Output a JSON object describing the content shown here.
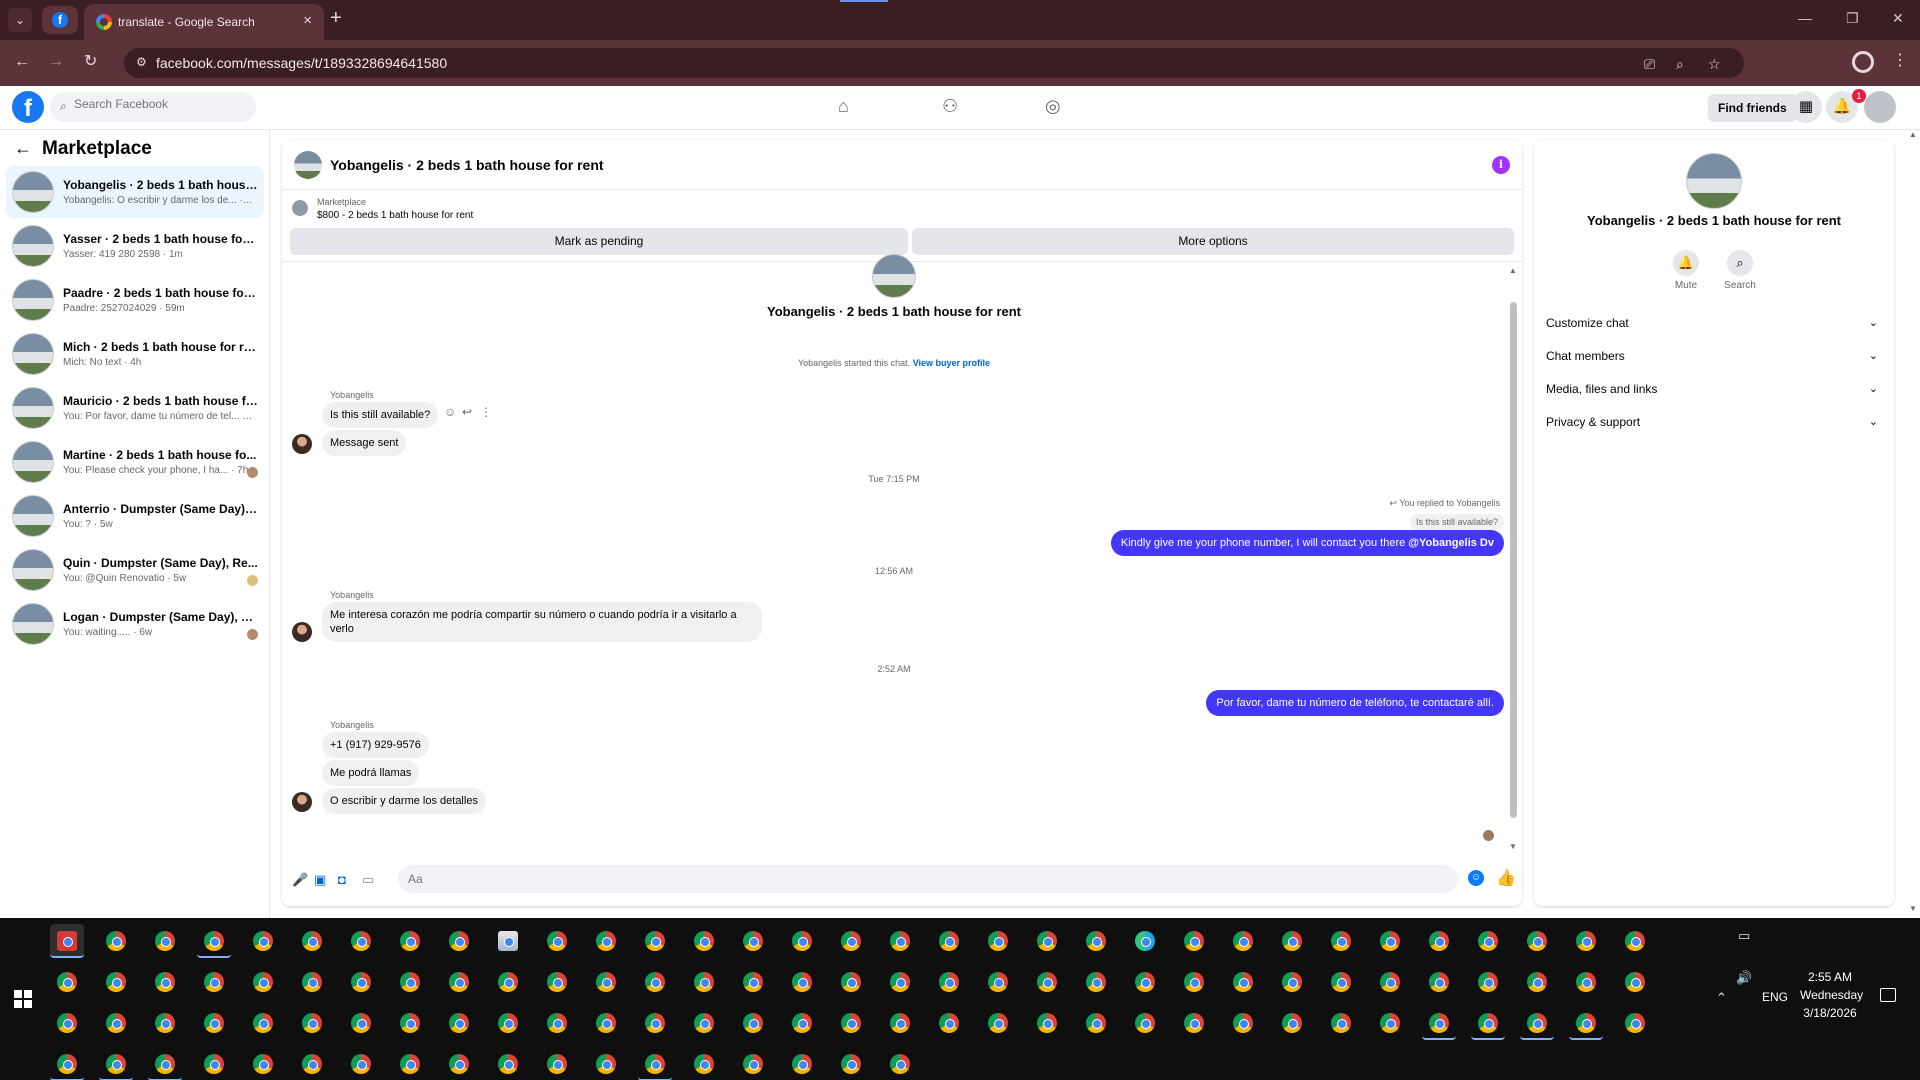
{
  "browser": {
    "tab_title": "translate - Google Search",
    "url": "facebook.com/messages/t/1893328694641580",
    "new_tab": "+",
    "close_tab": "×"
  },
  "fb": {
    "search_placeholder": "Search Facebook",
    "find_friends": "Find friends",
    "notification_count": "1"
  },
  "sidebar": {
    "title": "Marketplace",
    "conversations": [
      {
        "title": "Yobangelis · 2 beds 1 bath house f...",
        "preview": "Yobangelis: O escribir y darme los de... · 1m"
      },
      {
        "title": "Yasser · 2 beds 1 bath house for rent",
        "preview": "Yasser: 419 280 2598 · 1m"
      },
      {
        "title": "Paadre · 2 beds 1 bath house for re...",
        "preview": "Paadre: 2527024029 · 59m"
      },
      {
        "title": "Mich · 2 beds 1 bath house for rent",
        "preview": "Mich: No text · 4h"
      },
      {
        "title": "Mauricio · 2 beds 1 bath house for ...",
        "preview": "You: Por favor, dame tu número de tel... · 6h"
      },
      {
        "title": "Martine · 2 beds 1 bath house fo...",
        "preview": "You: Please check your phone, I ha... · 7h"
      },
      {
        "title": "Anterrio · Dumpster (Same Day), R...",
        "preview": "You: ? · 5w"
      },
      {
        "title": "Quin · Dumpster (Same Day), Re...",
        "preview": "You: @Quin Renovatio · 5w"
      },
      {
        "title": "Logan · Dumpster (Same Day), R...",
        "preview": "You: waiting..... · 6w"
      }
    ]
  },
  "chat": {
    "header_title": "Yobangelis · 2 beds 1 bath house for rent",
    "listing_source": "Marketplace",
    "listing_price": "$800 - 2 beds 1 bath house for rent",
    "mark_pending": "Mark as pending",
    "more_options": "More options",
    "center_name": "Yobangelis · 2 beds 1 bath house for rent",
    "started_note": "Yobangelis started this chat.",
    "view_profile": "View buyer profile",
    "sender": "Yobangelis",
    "msg1": "Is this still available?",
    "msg2": "Message sent",
    "time1": "Tue 7:15 PM",
    "replied_to": "You replied to Yobangelis",
    "quoted": "Is this still available?",
    "out1_text": "Kindly give me your phone number, I will contact you there ",
    "out1_mention": "@Yobangelis Dv",
    "time2": "12:56 AM",
    "msg3": "Me interesa corazón me podría compartir su número o cuando podría ir a visitarlo a verlo",
    "time3": "2:52 AM",
    "out2": "Por favor, dame tu número de teléfono, te contactaré allí.",
    "msg4": "+1 (917) 929-9576",
    "msg5": "Me podrá llamas",
    "msg6": "O escribir y darme los detalles",
    "composer_placeholder": "Aa"
  },
  "rpanel": {
    "name": "Yobangelis · 2 beds 1 bath house for rent",
    "mute": "Mute",
    "search": "Search",
    "rows": [
      "Customize chat",
      "Chat members",
      "Media, files and links",
      "Privacy & support"
    ]
  },
  "taskbar": {
    "time": "2:55 AM",
    "day": "Wednesday",
    "date": "3/18/2026",
    "lang": "ENG"
  },
  "colors": {
    "outgoing_bubble": "#4236ff",
    "fb_blue": "#1877f2",
    "browser_frame": "#5c3338"
  }
}
